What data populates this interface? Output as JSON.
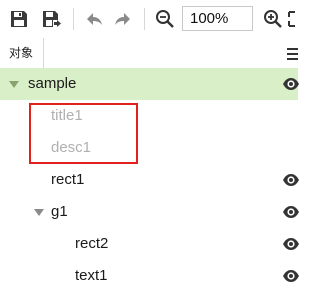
{
  "toolbar": {
    "buttons": [
      {
        "name": "save-icon"
      },
      {
        "name": "save-as-icon"
      },
      {
        "name": "undo-icon"
      },
      {
        "name": "redo-icon"
      },
      {
        "name": "zoom-out-icon"
      },
      {
        "name": "zoom-in-icon"
      }
    ],
    "zoom_value": "100%"
  },
  "panel": {
    "tab_label": "对象",
    "menu_icon": "hamburger-menu-icon"
  },
  "tree": {
    "items": [
      {
        "label": "sample",
        "expanded": true,
        "selected": true,
        "visible_icon": true
      },
      {
        "label": "title1",
        "dimmed": true,
        "visible_icon": false
      },
      {
        "label": "desc1",
        "dimmed": true,
        "visible_icon": false
      },
      {
        "label": "rect1",
        "visible_icon": true
      },
      {
        "label": "g1",
        "expanded": true,
        "visible_icon": true
      },
      {
        "label": "rect2",
        "visible_icon": true
      },
      {
        "label": "text1",
        "visible_icon": true
      }
    ]
  },
  "colors": {
    "selected_row": "#d9efc8",
    "highlight_border": "#e3211c",
    "dim_text": "#b0b0b0"
  }
}
